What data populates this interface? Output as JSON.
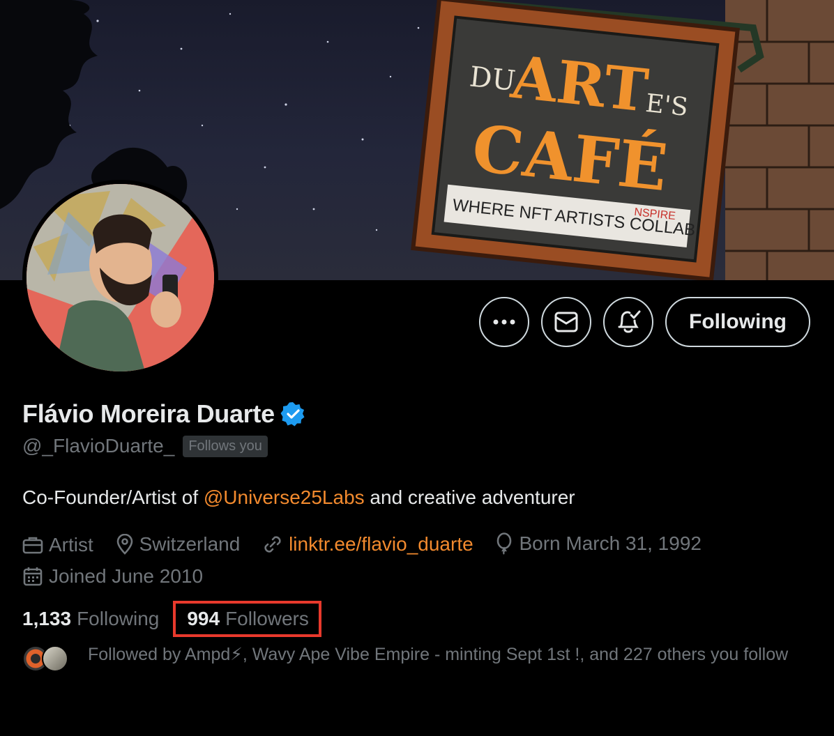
{
  "banner": {
    "sign_line1_small": "DU",
    "sign_line1_big": "ART",
    "sign_line1_suffix": "E'S",
    "sign_line2": "CAFÉ",
    "sign_tagline": "WHERE NFT ARTISTS COLLAB",
    "sign_annotation": "NSPIRE"
  },
  "actions": {
    "more_icon": "more-horizontal-icon",
    "message_icon": "envelope-icon",
    "notify_icon": "bell-check-icon",
    "following_label": "Following"
  },
  "profile": {
    "name": "Flávio Moreira Duarte",
    "verified_icon": "verified-badge-icon",
    "handle": "@_FlavioDuarte_",
    "follows_you": "Follows you",
    "bio_prefix": "Co-Founder/Artist of ",
    "bio_mention": "@Universe25Labs",
    "bio_suffix": " and creative adventurer",
    "profession": "Artist",
    "location": "Switzerland",
    "link": "linktr.ee/flavio_duarte",
    "birthday": "Born March 31, 1992",
    "joined": "Joined June 2010"
  },
  "stats": {
    "following_count": "1,133",
    "following_label": "Following",
    "followers_count": "994",
    "followers_label": "Followers"
  },
  "followed_by": {
    "text": "Followed by Ampd⚡, Wavy Ape Vibe Empire - minting Sept 1st !, and 227 others you follow"
  },
  "colors": {
    "accent": "#f28a2e",
    "highlight_box": "#e8392c",
    "verified": "#1d9bf0",
    "muted_text": "#71767b"
  }
}
